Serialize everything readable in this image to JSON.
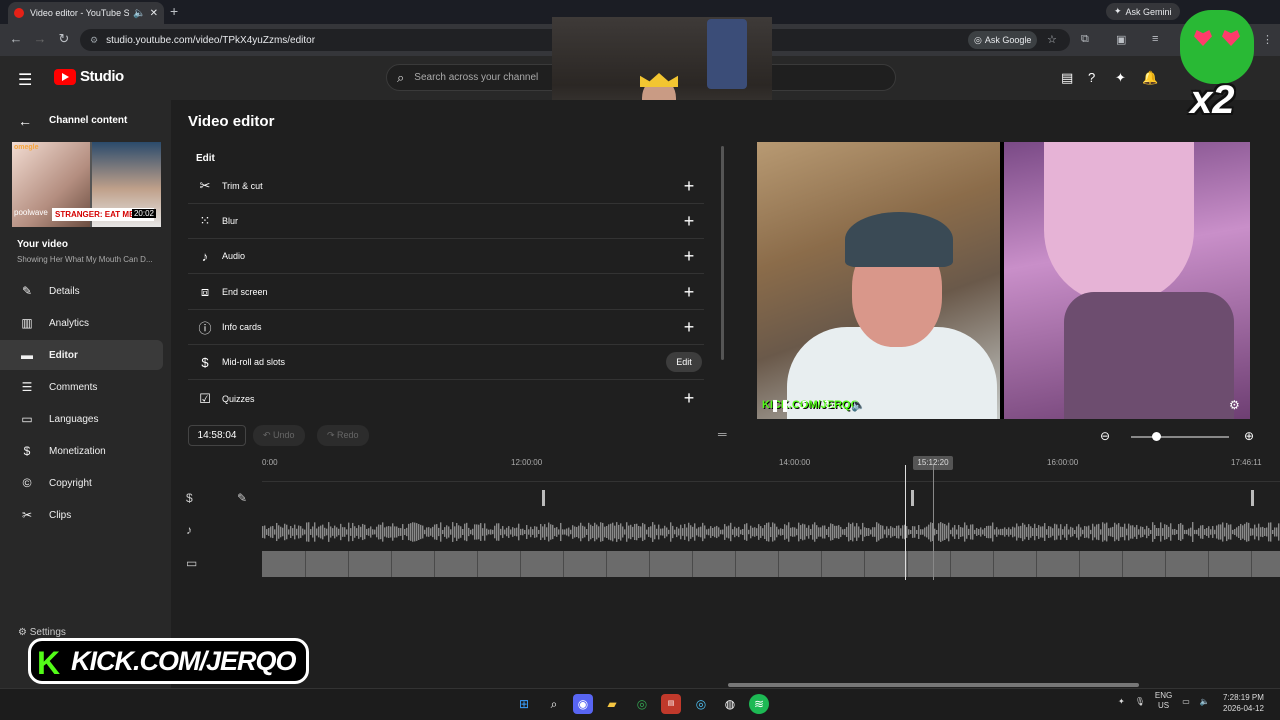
{
  "browser": {
    "tab_title": "Video editor - YouTube Stu",
    "new_tab": "+",
    "ask_gemini": "Ask Gemini",
    "url": "studio.youtube.com/video/TPkX4yuZzms/editor",
    "ask_google": "Ask Google"
  },
  "header": {
    "logo_text": "Studio",
    "search_placeholder": "Search across your channel"
  },
  "sidebar": {
    "back_label": "Channel content",
    "thumb_omegle": "omegle",
    "thumb_user": "poolwave",
    "thumb_caption": "STRANGER: EAT ME",
    "thumb_duration": "20:02",
    "your_video": "Your video",
    "video_title": "Showing Her What My Mouth Can D...",
    "items": [
      {
        "label": "Details",
        "icon": "pencil-icon"
      },
      {
        "label": "Analytics",
        "icon": "analytics-icon"
      },
      {
        "label": "Editor",
        "icon": "editor-icon"
      },
      {
        "label": "Comments",
        "icon": "comments-icon"
      },
      {
        "label": "Languages",
        "icon": "languages-icon"
      },
      {
        "label": "Monetization",
        "icon": "dollar-icon"
      },
      {
        "label": "Copyright",
        "icon": "copyright-icon"
      },
      {
        "label": "Clips",
        "icon": "scissors-icon"
      }
    ],
    "active_index": 2,
    "settings_label": "Settings"
  },
  "main": {
    "page_title": "Video editor",
    "edit_heading": "Edit",
    "edit_rows": [
      {
        "label": "Trim & cut",
        "icon": "scissors-icon",
        "action": "+"
      },
      {
        "label": "Blur",
        "icon": "blur-icon",
        "action": "+"
      },
      {
        "label": "Audio",
        "icon": "music-note-icon",
        "action": "+"
      },
      {
        "label": "End screen",
        "icon": "end-screen-icon",
        "action": "+"
      },
      {
        "label": "Info cards",
        "icon": "info-icon",
        "action": "+"
      },
      {
        "label": "Mid-roll ad slots",
        "icon": "dollar-icon",
        "action": "Edit"
      },
      {
        "label": "Quizzes",
        "icon": "checkbox-icon",
        "action": "+"
      }
    ]
  },
  "preview": {
    "watermark": "KICK.COM/JERQO"
  },
  "timeline": {
    "timecode": "14:58:04",
    "undo": "Undo",
    "redo": "Redo",
    "ticks": [
      "0:00",
      "12:00:00",
      "14:00:00",
      "16:00:00",
      "17:46:11"
    ],
    "playhead_label": "15:12:20"
  },
  "overlay": {
    "multiplier": "x2",
    "kick_banner": "KICK.COM/JERQO"
  },
  "taskbar": {
    "lang": "ENG",
    "region": "US",
    "time": "7:28:19 PM",
    "date": "2026-04-12"
  },
  "colors": {
    "youtube_red": "#ff0000",
    "kick_green": "#53fc18",
    "background": "#1f1f1f",
    "sidebar": "#282828"
  }
}
